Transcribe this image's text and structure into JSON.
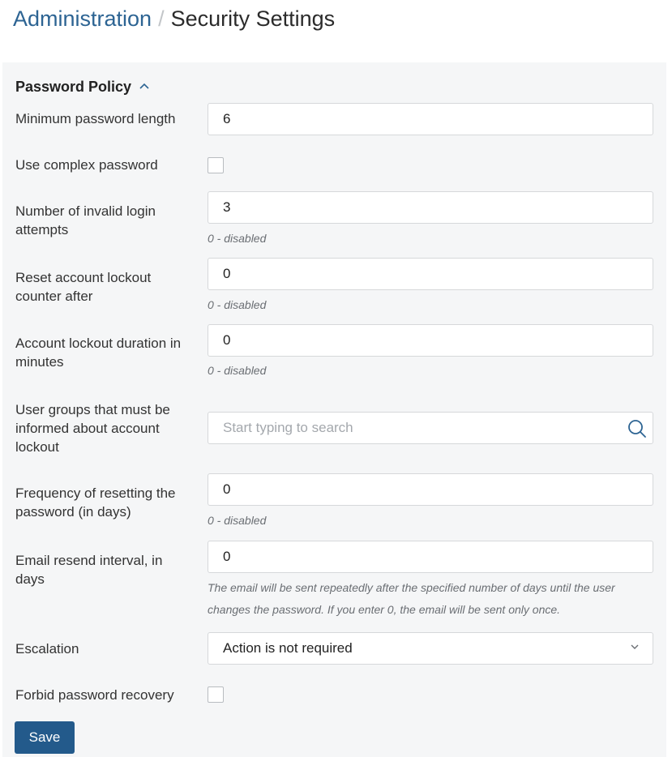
{
  "breadcrumb": {
    "parent": "Administration",
    "separator": "/",
    "current": "Security Settings"
  },
  "section": {
    "title": "Password Policy"
  },
  "fields": {
    "min_length": {
      "label": "Minimum password length",
      "value": "6"
    },
    "complex_password": {
      "label": "Use complex password",
      "checked": false
    },
    "invalid_attempts": {
      "label": "Number of invalid login attempts",
      "value": "3",
      "hint": "0 - disabled"
    },
    "reset_counter": {
      "label": "Reset account lockout counter after",
      "value": "0",
      "hint": "0 - disabled"
    },
    "lockout_duration": {
      "label": "Account lockout duration in minutes",
      "value": "0",
      "hint": "0 - disabled"
    },
    "user_groups": {
      "label": "User groups that must be informed about account lockout",
      "placeholder": "Start typing to search"
    },
    "reset_frequency": {
      "label": "Frequency of resetting the password (in days)",
      "value": "0",
      "hint": "0 - disabled"
    },
    "email_resend": {
      "label": "Email resend interval, in days",
      "value": "0",
      "hint_line1": "The email will be sent repeatedly after the specified number of days until the user",
      "hint_line2": "changes the password. If you enter 0, the email will be sent only once."
    },
    "escalation": {
      "label": "Escalation",
      "selected": "Action is not required"
    },
    "forbid_recovery": {
      "label": "Forbid password recovery",
      "checked": false
    }
  },
  "actions": {
    "save_label": "Save"
  },
  "colors": {
    "link": "#2d6493",
    "button": "#235a8b",
    "panel": "#f5f6f7"
  },
  "icons": [
    "chevron-up-icon",
    "search-icon",
    "chevron-down-icon"
  ]
}
